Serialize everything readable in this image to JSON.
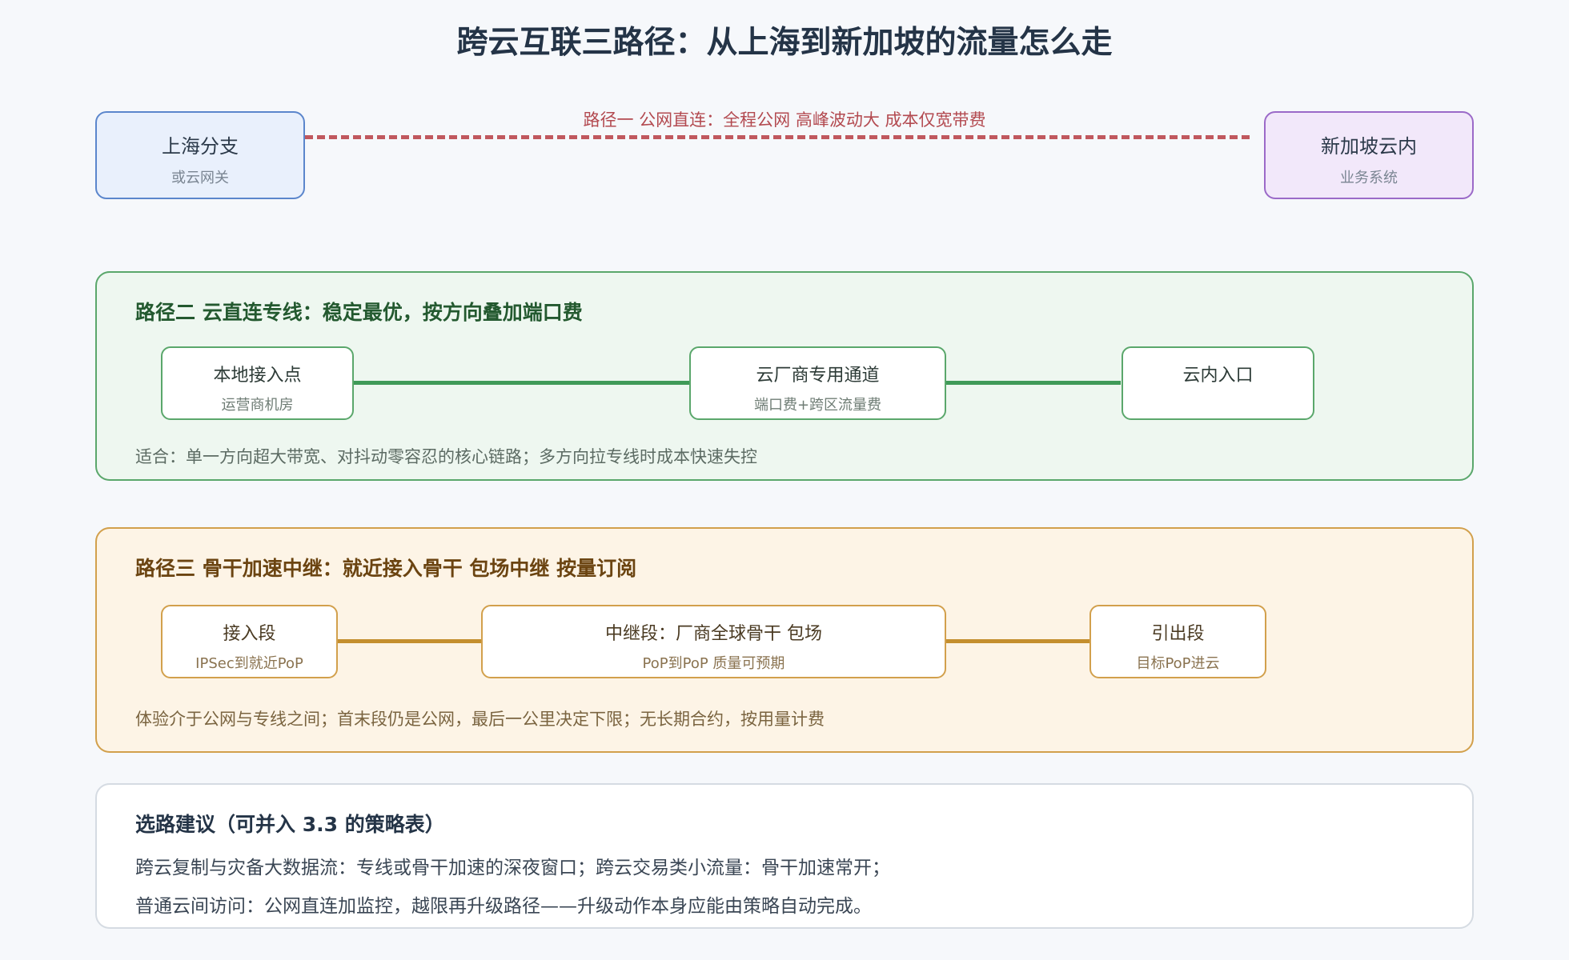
{
  "title": "跨云互联三路径：从上海到新加坡的流量怎么走",
  "route1": {
    "source": {
      "name": "上海分支",
      "sub": "或云网关"
    },
    "target": {
      "name": "新加坡云内",
      "sub": "业务系统"
    },
    "label": "路径一 公网直连：全程公网 高峰波动大 成本仅宽带费"
  },
  "route2": {
    "heading": "路径二 云直连专线：稳定最优，按方向叠加端口费",
    "nodes": [
      {
        "name": "本地接入点",
        "sub": "运营商机房"
      },
      {
        "name": "云厂商专用通道",
        "sub": "端口费+跨区流量费"
      },
      {
        "name": "云内入口",
        "sub": ""
      }
    ],
    "note": "适合：单一方向超大带宽、对抖动零容忍的核心链路；多方向拉专线时成本快速失控"
  },
  "route3": {
    "heading": "路径三 骨干加速中继：就近接入骨干 包场中继 按量订阅",
    "nodes": [
      {
        "name": "接入段",
        "sub": "IPSec到就近PoP"
      },
      {
        "name": "中继段：厂商全球骨干 包场",
        "sub": "PoP到PoP 质量可预期"
      },
      {
        "name": "引出段",
        "sub": "目标PoP进云"
      }
    ],
    "note": "体验介于公网与专线之间；首末段仍是公网，最后一公里决定下限；无长期合约，按用量计费"
  },
  "advice": {
    "heading": "选路建议（可并入 3.3 的策略表）",
    "lines": [
      "跨云复制与灾备大数据流：专线或骨干加速的深夜窗口；跨云交易类小流量：骨干加速常开；",
      "普通云间访问：公网直连加监控，越限再升级路径——升级动作本身应能由策略自动完成。"
    ]
  }
}
